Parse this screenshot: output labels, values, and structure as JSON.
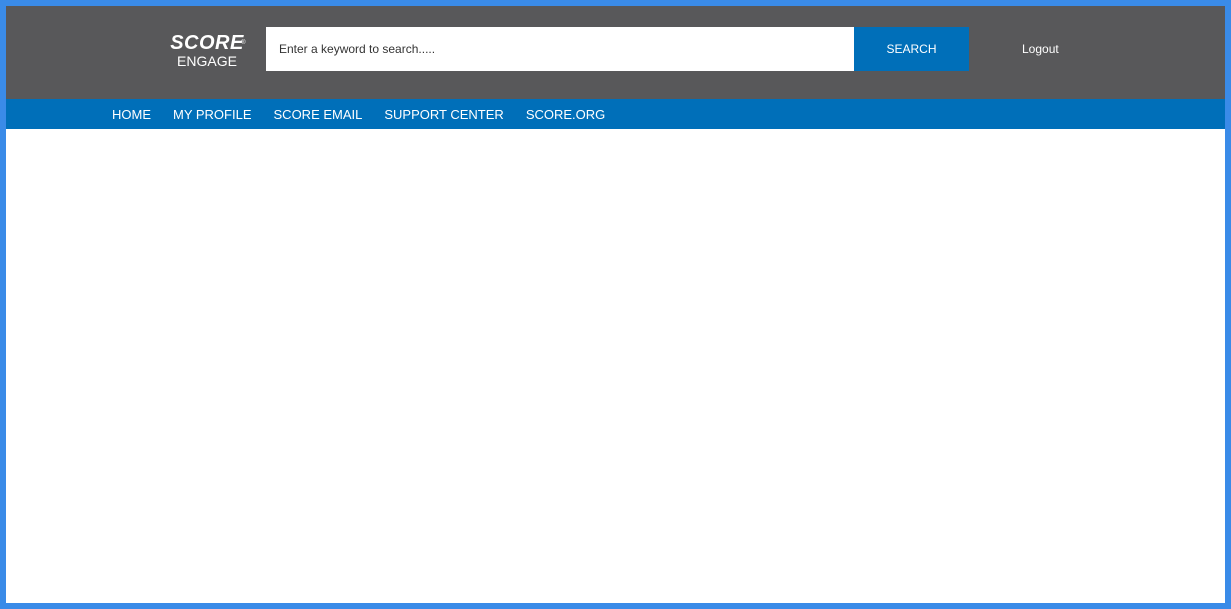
{
  "colors": {
    "header_bg": "#58585a",
    "nav_bg": "#006fb9",
    "accent": "#006fb9",
    "frame_border": "#3a8be8",
    "content_bg": "#ffffff"
  },
  "header": {
    "logo": {
      "top": "SCORE",
      "registered": "®",
      "bottom": "ENGAGE"
    },
    "search": {
      "placeholder": "Enter a keyword to search.....",
      "value": "",
      "button_label": "SEARCH"
    },
    "logout_label": "Logout"
  },
  "nav": {
    "items": [
      {
        "label": "HOME"
      },
      {
        "label": "MY PROFILE"
      },
      {
        "label": "SCORE EMAIL"
      },
      {
        "label": "SUPPORT CENTER"
      },
      {
        "label": "SCORE.ORG"
      }
    ]
  }
}
